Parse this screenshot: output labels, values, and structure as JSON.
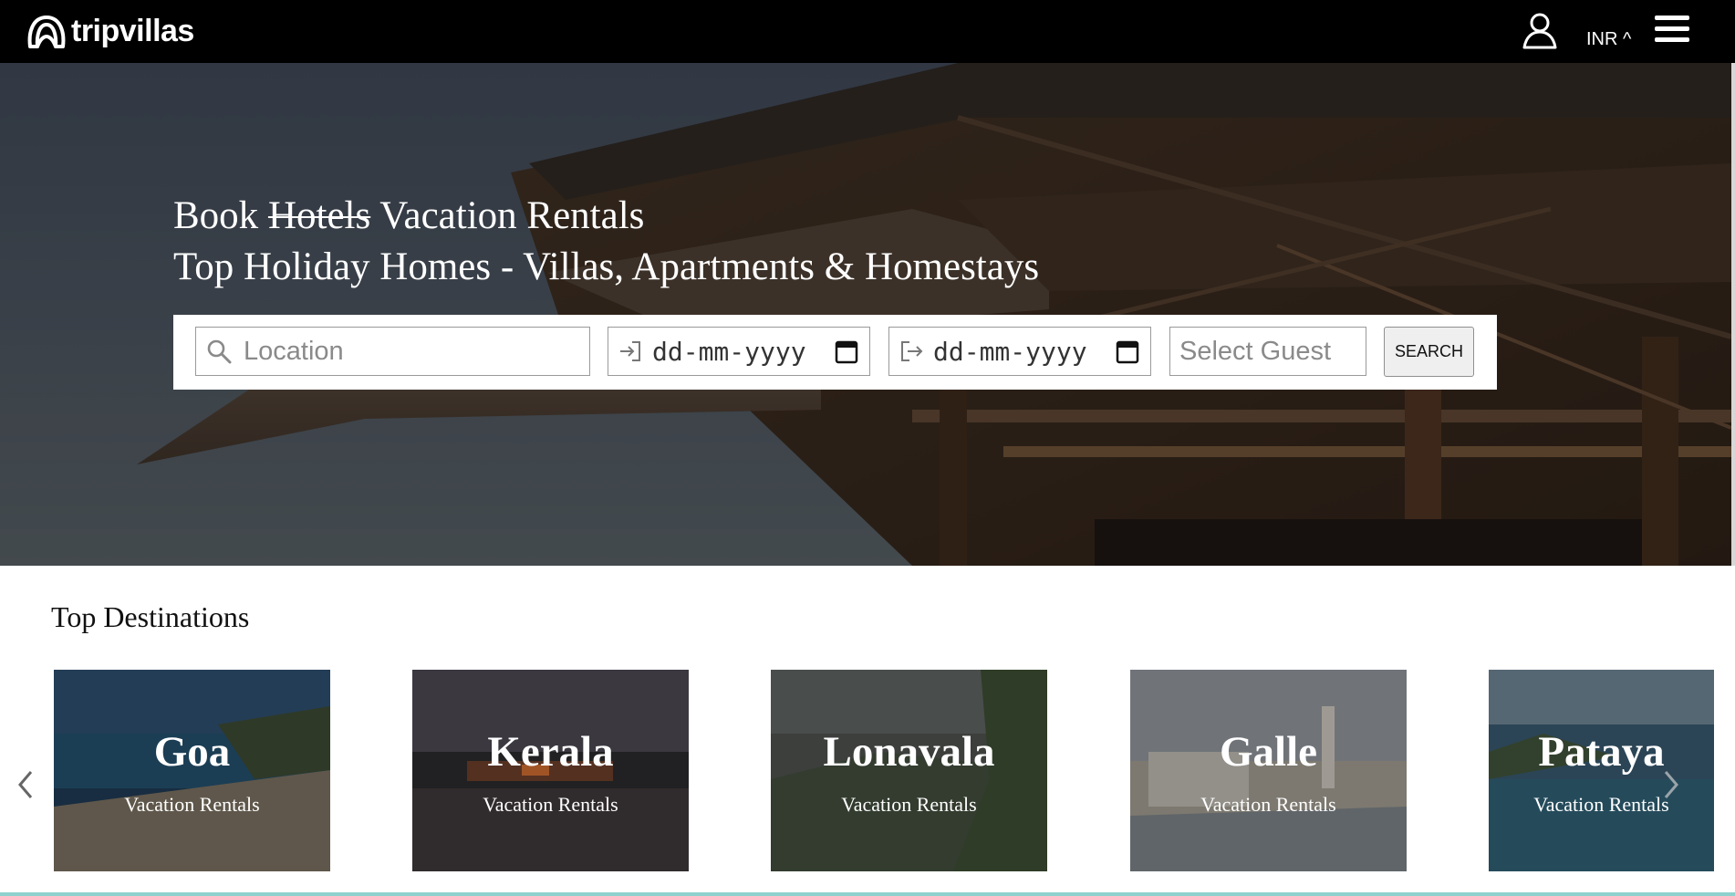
{
  "header": {
    "logo_text": "tripvillas",
    "logo_icon": "tripvillas-logo-icon",
    "user_icon": "user-icon",
    "currency": "INR ^",
    "menu_icon": "hamburger-menu-icon"
  },
  "hero": {
    "line1_prefix": "Book",
    "line1_struck": "Hotels",
    "line1_suffix": "Vacation Rentals",
    "line2": "Top Holiday Homes - Villas, Apartments & Homestays"
  },
  "search": {
    "location_placeholder": "Location",
    "checkin_value": "dd-mm-yyyy",
    "checkout_value": "dd-mm-yyyy",
    "guest_placeholder": "Select Guest",
    "button_label": "SEARCH"
  },
  "destinations": {
    "title": "Top Destinations",
    "items": [
      {
        "name": "Goa",
        "subtitle": "Vacation Rentals"
      },
      {
        "name": "Kerala",
        "subtitle": "Vacation Rentals"
      },
      {
        "name": "Lonavala",
        "subtitle": "Vacation Rentals"
      },
      {
        "name": "Galle",
        "subtitle": "Vacation Rentals"
      },
      {
        "name": "Pataya",
        "subtitle": "Vacation Rentals"
      }
    ]
  },
  "colors": {
    "header_bg": "#000000",
    "accent_line": "#8fd1cd"
  }
}
